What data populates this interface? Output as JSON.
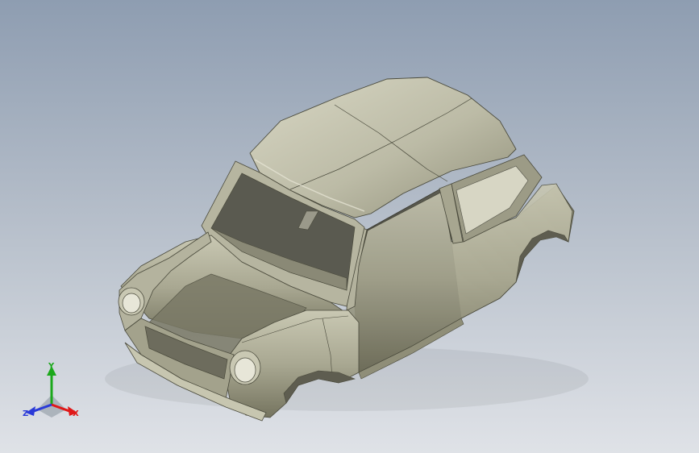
{
  "viewport": {
    "background_top": "#8e9db1",
    "background_bottom": "#dfe2e7",
    "model_name": "car-body-shell"
  },
  "triad": {
    "x_label": "X",
    "y_label": "Y",
    "z_label": "Z",
    "colors": {
      "x": "#e01818",
      "y": "#1ba81b",
      "z": "#2a3ad8"
    }
  }
}
